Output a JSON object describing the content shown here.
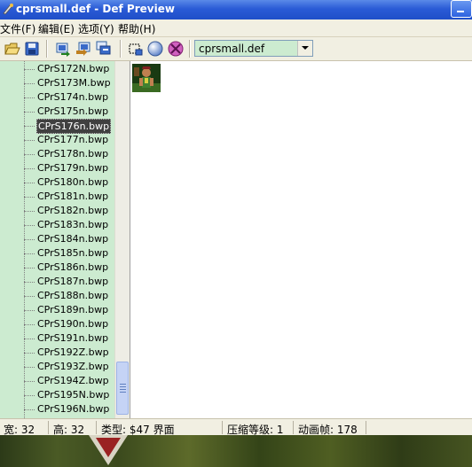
{
  "window": {
    "title": "cprsmall.def - Def Preview"
  },
  "menu": [
    {
      "label": "文件(F)"
    },
    {
      "label": "编辑(E)"
    },
    {
      "label": "选项(Y)"
    },
    {
      "label": "帮助(H)"
    }
  ],
  "toolbar": {
    "file_combo_value": "cprsmall.def",
    "icons": [
      "open-folder-icon",
      "save-disk-icon",
      "export-icon",
      "import-icon",
      "frames-icon",
      "window-icon",
      "sphere-icon",
      "no-entry-icon"
    ]
  },
  "tree": {
    "items": [
      "CPrS172N.bwp",
      "CPrS173M.bwp",
      "CPrS174n.bwp",
      "CPrS175n.bwp",
      "CPrS176n.bwp",
      "CPrS177n.bwp",
      "CPrS178n.bwp",
      "CPrS179n.bwp",
      "CPrS180n.bwp",
      "CPrS181n.bwp",
      "CPrS182n.bwp",
      "CPrS183n.bwp",
      "CPrS184n.bwp",
      "CPrS185n.bwp",
      "CPrS186n.bwp",
      "CPrS187n.bwp",
      "CPrS188n.bwp",
      "CPrS189n.bwp",
      "CPrS190n.bwp",
      "CPrS191n.bwp",
      "CPrS192Z.bwp",
      "CPrS193Z.bwp",
      "CPrS194Z.bwp",
      "CPrS195N.bwp",
      "CPrS196N.bwp"
    ],
    "selected_index": 4
  },
  "status": {
    "width": "宽: 32",
    "height": "高: 32",
    "type": "类型: $47 界面",
    "compression": "压缩等级: 1",
    "frame": "动画帧: 178"
  }
}
